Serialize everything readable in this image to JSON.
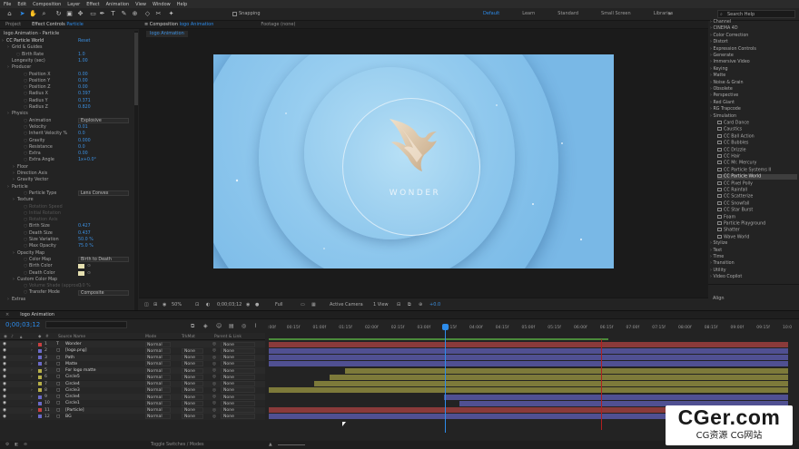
{
  "menu": [
    "File",
    "Edit",
    "Composition",
    "Layer",
    "Effect",
    "Animation",
    "View",
    "Window",
    "Help"
  ],
  "toolbar": {
    "snapping_label": "Snapping",
    "workspaces": [
      "Default",
      "Learn",
      "Standard",
      "Small Screen",
      "Libraries"
    ],
    "active_workspace": "Default",
    "overflow": "»",
    "search_placeholder": "Search Help"
  },
  "effect_panel": {
    "tabs": {
      "project": "Project",
      "effect_controls": "Effect Controls",
      "effect_name": "Particle"
    },
    "title": "logo Animation - Particle",
    "rows": [
      {
        "name": "CC Particle World",
        "value": "Reset",
        "level": 0,
        "type": "value"
      },
      {
        "name": "Grid & Guides",
        "value": "",
        "level": 1,
        "type": "group"
      },
      {
        "name": "Birth Rate",
        "value": "1.0",
        "level": 2,
        "type": "value"
      },
      {
        "name": "Longevity (sec)",
        "value": "1.00",
        "level": 1,
        "type": "value"
      },
      {
        "name": "Producer",
        "value": "",
        "level": 1,
        "type": "group"
      },
      {
        "name": "Position X",
        "value": "0.00",
        "level": 3,
        "type": "value"
      },
      {
        "name": "Position Y",
        "value": "0.00",
        "level": 3,
        "type": "value"
      },
      {
        "name": "Position Z",
        "value": "0.00",
        "level": 3,
        "type": "value"
      },
      {
        "name": "Radius X",
        "value": "0.397",
        "level": 3,
        "type": "value"
      },
      {
        "name": "Radius Y",
        "value": "0.371",
        "level": 3,
        "type": "value"
      },
      {
        "name": "Radius Z",
        "value": "0.820",
        "level": 3,
        "type": "value"
      },
      {
        "name": "Physics",
        "value": "",
        "level": 1,
        "type": "group"
      },
      {
        "name": "Animation",
        "value": "Explosive",
        "level": 3,
        "type": "dropdown"
      },
      {
        "name": "Velocity",
        "value": "0.01",
        "level": 3,
        "type": "value"
      },
      {
        "name": "Inherit Velocity %",
        "value": "0.0",
        "level": 3,
        "type": "value"
      },
      {
        "name": "Gravity",
        "value": "0.000",
        "level": 3,
        "type": "value"
      },
      {
        "name": "Resistance",
        "value": "0.0",
        "level": 3,
        "type": "value"
      },
      {
        "name": "Extra",
        "value": "0.00",
        "level": 3,
        "type": "value"
      },
      {
        "name": "Extra Angle",
        "value": "1x+0.0°",
        "level": 3,
        "type": "value"
      },
      {
        "name": "Floor",
        "value": "",
        "level": 2,
        "type": "group"
      },
      {
        "name": "Direction Axis",
        "value": "",
        "level": 2,
        "type": "group"
      },
      {
        "name": "Gravity Vector",
        "value": "",
        "level": 2,
        "type": "group"
      },
      {
        "name": "Particle",
        "value": "",
        "level": 1,
        "type": "group"
      },
      {
        "name": "Particle Type",
        "value": "Lens Convex",
        "level": 3,
        "type": "dropdown"
      },
      {
        "name": "Texture",
        "value": "",
        "level": 2,
        "type": "group"
      },
      {
        "name": "Rotation Speed",
        "value": "",
        "level": 3,
        "type": "dim"
      },
      {
        "name": "Initial Rotation",
        "value": "",
        "level": 3,
        "type": "dim"
      },
      {
        "name": "Rotation Axis",
        "value": "",
        "level": 3,
        "type": "dim"
      },
      {
        "name": "Birth Size",
        "value": "0.427",
        "level": 3,
        "type": "value"
      },
      {
        "name": "Death Size",
        "value": "0.437",
        "level": 3,
        "type": "value"
      },
      {
        "name": "Size Variation",
        "value": "50.0 %",
        "level": 3,
        "type": "value"
      },
      {
        "name": "Max Opacity",
        "value": "75.0 %",
        "level": 3,
        "type": "value"
      },
      {
        "name": "Opacity Map",
        "value": "",
        "level": 2,
        "type": "group"
      },
      {
        "name": "Color Map",
        "value": "Birth to Death",
        "level": 3,
        "type": "dropdown"
      },
      {
        "name": "Birth Color",
        "value": "",
        "level": 3,
        "type": "swatch"
      },
      {
        "name": "Death Color",
        "value": "",
        "level": 3,
        "type": "swatch"
      },
      {
        "name": "Custom Color Map",
        "value": "",
        "level": 2,
        "type": "group"
      },
      {
        "name": "Volume Shade (approx.)",
        "value": "0.0 %",
        "level": 3,
        "type": "dim"
      },
      {
        "name": "Transfer Mode",
        "value": "Composite",
        "level": 3,
        "type": "dropdown"
      },
      {
        "name": "Extras",
        "value": "",
        "level": 1,
        "type": "group"
      }
    ]
  },
  "comp_panel": {
    "tabs": {
      "composition_prefix": "Composition",
      "composition_name": "logo Animation",
      "footage": "Footage (none)"
    },
    "breadcrumb": "logo Animation",
    "canvas_text": "WONDER",
    "viewer": {
      "zoom": "50%",
      "timecode": "0;00;03;12",
      "resolution": "Full",
      "camera": "Active Camera",
      "view": "1 View",
      "exposure": "+0.0"
    }
  },
  "right_panel": {
    "categories_top": [
      "Channel",
      "CINEMA 4D",
      "Color Correction",
      "Distort",
      "Expression Controls",
      "Generate",
      "Immersive Video",
      "Keying",
      "Matte",
      "Noise & Grain",
      "Obsolete",
      "Perspective",
      "Red Giant",
      "RG Trapcode"
    ],
    "simulation_category": "Simulation",
    "simulation_items": [
      "Card Dance",
      "Caustics",
      "CC Ball Action",
      "CC Bubbles",
      "CC Drizzle",
      "CC Hair",
      "CC Mr. Mercury",
      "CC Particle Systems II",
      "CC Particle World",
      "CC Pixel Polly",
      "CC Rainfall",
      "CC Scatterize",
      "CC Snowfall",
      "CC Star Burst",
      "Foam",
      "Particle Playground",
      "Shatter",
      "Wave World"
    ],
    "selected_item": "CC Particle World",
    "categories_bottom": [
      "Stylize",
      "Text",
      "Time",
      "Transition",
      "Utility",
      "Video Copilot"
    ],
    "align_tab": "Align"
  },
  "timeline": {
    "tab": "logo Animation",
    "timecode": "0;00;03;12",
    "columns": {
      "source": "Source Name",
      "mode": "Mode",
      "trkmat": "TrkMat",
      "parent": "Parent & Link"
    },
    "ruler_labels": [
      ":00f",
      "00:15f",
      "01:00f",
      "01:15f",
      "02:00f",
      "02:15f",
      "03:00f",
      "03:15f",
      "04:00f",
      "04:15f",
      "05:00f",
      "05:15f",
      "06:00f",
      "06:15f",
      "07:00f",
      "07:15f",
      "08:00f",
      "08:15f",
      "09:00f",
      "09:15f",
      "10:0"
    ],
    "layers": [
      {
        "num": "1",
        "name": "Wonder",
        "mode": "Normal",
        "trkmat": "",
        "parent": "None",
        "label_color": "#c84040",
        "bar_color": "#8a3a3a",
        "bar_start": 0.0,
        "bar_end": 1.0
      },
      {
        "num": "2",
        "name": "[logo.png]",
        "mode": "Normal",
        "trkmat": "None",
        "parent": "None",
        "label_color": "#6a6ac8",
        "bar_color": "#505092",
        "bar_start": 0.0,
        "bar_end": 1.0
      },
      {
        "num": "3",
        "name": "Path",
        "mode": "Normal",
        "trkmat": "None",
        "parent": "None",
        "label_color": "#6a6ac8",
        "bar_color": "#505092",
        "bar_start": 0.0,
        "bar_end": 1.0
      },
      {
        "num": "4",
        "name": "Matte",
        "mode": "Normal",
        "trkmat": "None",
        "parent": "None",
        "label_color": "#6a6ac8",
        "bar_color": "#505092",
        "bar_start": 0.0,
        "bar_end": 1.0
      },
      {
        "num": "5",
        "name": "For logo matte",
        "mode": "Normal",
        "trkmat": "None",
        "parent": "None",
        "label_color": "#b8b048",
        "bar_color": "#7d7a3a",
        "bar_start": 0.147,
        "bar_end": 1.0
      },
      {
        "num": "6",
        "name": "Circle5",
        "mode": "Normal",
        "trkmat": "None",
        "parent": "None",
        "label_color": "#b8b048",
        "bar_color": "#7d7a3a",
        "bar_start": 0.118,
        "bar_end": 1.0
      },
      {
        "num": "7",
        "name": "Circle4",
        "mode": "Normal",
        "trkmat": "None",
        "parent": "None",
        "label_color": "#b8b048",
        "bar_color": "#7d7a3a",
        "bar_start": 0.088,
        "bar_end": 1.0
      },
      {
        "num": "8",
        "name": "Circle3",
        "mode": "Normal",
        "trkmat": "None",
        "parent": "None",
        "label_color": "#b8b048",
        "bar_color": "#7d7a3a",
        "bar_start": 0.0,
        "bar_end": 1.0
      },
      {
        "num": "9",
        "name": "Circle4",
        "mode": "Normal",
        "trkmat": "None",
        "parent": "None",
        "label_color": "#6a6ac8",
        "bar_color": "#505092",
        "bar_start": 0.338,
        "bar_end": 1.0
      },
      {
        "num": "10",
        "name": "Circle1",
        "mode": "Normal",
        "trkmat": "None",
        "parent": "None",
        "label_color": "#6a6ac8",
        "bar_color": "#505092",
        "bar_start": 0.367,
        "bar_end": 1.0
      },
      {
        "num": "11",
        "name": "[Particle]",
        "mode": "Normal",
        "trkmat": "None",
        "parent": "None",
        "label_color": "#c84040",
        "bar_color": "#8a3a3a",
        "bar_start": 0.0,
        "bar_end": 1.0
      },
      {
        "num": "12",
        "name": "BG",
        "mode": "Normal",
        "trkmat": "None",
        "parent": "None",
        "label_color": "#6a6ac8",
        "bar_color": "#505092",
        "bar_start": 0.0,
        "bar_end": 1.0
      }
    ],
    "footer_label": "Toggle Switches / Modes"
  },
  "watermark": {
    "line1": "CGer.com",
    "line2": "CG资源  CG网站"
  }
}
